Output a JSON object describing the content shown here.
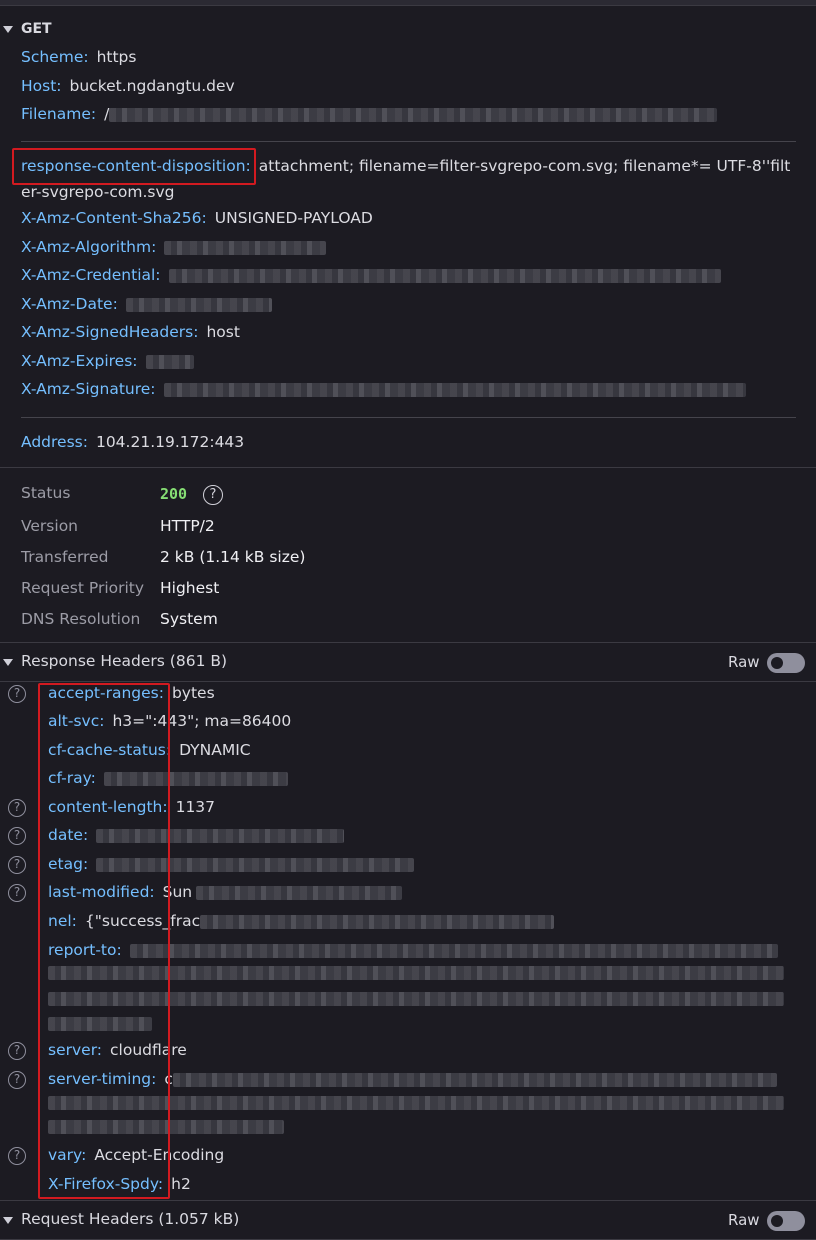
{
  "request": {
    "method": "GET",
    "fields": [
      {
        "key": "Scheme:",
        "value": "https"
      },
      {
        "key": "Host:",
        "value": "bucket.ngdangtu.dev"
      },
      {
        "key": "Filename:",
        "value": "/"
      }
    ],
    "params": [
      {
        "key": "response-content-disposition:",
        "value": "attachment; filename=filter-svgrepo-com.svg; filename*= UTF-8''filt",
        "value2": "er-svgrepo-com.svg"
      },
      {
        "key": "X-Amz-Content-Sha256:",
        "value": "UNSIGNED-PAYLOAD"
      },
      {
        "key": "X-Amz-Algorithm:",
        "value": ""
      },
      {
        "key": "X-Amz-Credential:",
        "value": ""
      },
      {
        "key": "X-Amz-Date:",
        "value": ""
      },
      {
        "key": "X-Amz-SignedHeaders:",
        "value": "host"
      },
      {
        "key": "X-Amz-Expires:",
        "value": ""
      },
      {
        "key": "X-Amz-Signature:",
        "value": ""
      }
    ],
    "address_key": "Address:",
    "address_value": "104.21.19.172:443"
  },
  "status": {
    "status_label": "Status",
    "status_value": "200",
    "help_glyph": "?",
    "version_label": "Version",
    "version_value": "HTTP/2",
    "transferred_label": "Transferred",
    "transferred_value": "2 kB (1.14 kB size)",
    "priority_label": "Request Priority",
    "priority_value": "Highest",
    "dns_label": "DNS Resolution",
    "dns_value": "System",
    "status_color": "#86de74"
  },
  "response_headers": {
    "title": "Response Headers (861 B)",
    "raw_label": "Raw",
    "items": [
      {
        "key": "accept-ranges:",
        "value": "bytes"
      },
      {
        "key": "alt-svc:",
        "value": "h3=\":443\"; ma=86400"
      },
      {
        "key": "cf-cache-status:",
        "value": "DYNAMIC"
      },
      {
        "key": "cf-ray:",
        "value": ""
      },
      {
        "key": "content-length:",
        "value": "1137"
      },
      {
        "key": "date:",
        "value": ""
      },
      {
        "key": "etag:",
        "value": ""
      },
      {
        "key": "last-modified:",
        "value": "Sun"
      },
      {
        "key": "nel:",
        "value": "{\"success_frac"
      },
      {
        "key": "report-to:",
        "value": ""
      },
      {
        "key": "server:",
        "value": "cloudflare"
      },
      {
        "key": "server-timing:",
        "value": "c"
      },
      {
        "key": "vary:",
        "value": "Accept-Encoding"
      },
      {
        "key": "X-Firefox-Spdy:",
        "value": "h2"
      }
    ]
  },
  "request_headers": {
    "title": "Request Headers (1.057 kB)",
    "raw_label": "Raw"
  },
  "colors": {
    "background": "#1c1b22",
    "key": "#75bfff",
    "highlight_box": "#d21a20"
  }
}
